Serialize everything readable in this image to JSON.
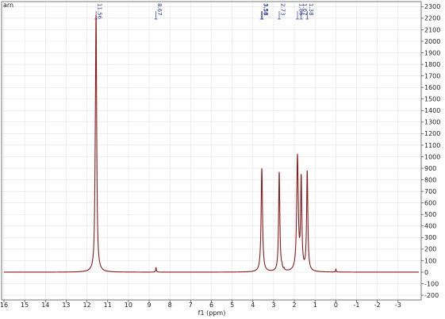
{
  "corner_label": "arn",
  "chart_data": {
    "type": "line",
    "title": "",
    "xlabel": "f1 (ppm)",
    "ylabel": "",
    "xlim": [
      16,
      -4
    ],
    "ylim": [
      -200,
      2400
    ],
    "x_reversed": true,
    "grid": true,
    "x_ticks": [
      16,
      15,
      14,
      13,
      12,
      11,
      10,
      9,
      8,
      7,
      6,
      5,
      4,
      3,
      2,
      1,
      0,
      -1,
      -2,
      -3
    ],
    "x_tick_labels": [
      "16",
      "15",
      "14",
      "13",
      "12",
      "11",
      "10",
      "9",
      "8",
      "7",
      "6",
      "5",
      "4",
      "3",
      "2",
      "1",
      "0",
      "-1",
      "-2",
      "-3"
    ],
    "y_ticks": [
      -200,
      -100,
      0,
      100,
      200,
      300,
      400,
      500,
      600,
      700,
      800,
      900,
      1000,
      1100,
      1200,
      1300,
      1400,
      1500,
      1600,
      1700,
      1800,
      1900,
      2000,
      2100,
      2200,
      2300
    ],
    "y_tick_labels": [
      "-200",
      "-100",
      "0",
      "100",
      "200",
      "300",
      "400",
      "500",
      "600",
      "700",
      "800",
      "900",
      "1000",
      "1100",
      "1200",
      "1300",
      "1400",
      "1500",
      "1600",
      "1700",
      "1800",
      "1900",
      "2000",
      "2100",
      "2200",
      "2300"
    ],
    "series": [
      {
        "color": "#8b1a1a",
        "baseline": 0,
        "peaks": [
          {
            "x": 11.56,
            "height": 2120,
            "width": 0.035
          },
          {
            "x": 11.6,
            "height": 300,
            "width": 0.03
          },
          {
            "x": 8.67,
            "height": 40,
            "width": 0.02
          },
          {
            "x": 3.57,
            "height": 895,
            "width": 0.04
          },
          {
            "x": 2.73,
            "height": 860,
            "width": 0.035
          },
          {
            "x": 2.6,
            "height": 25,
            "width": 0.02
          },
          {
            "x": 2.5,
            "height": 15,
            "width": 0.02
          },
          {
            "x": 1.85,
            "height": 985,
            "width": 0.045
          },
          {
            "x": 1.67,
            "height": 780,
            "width": 0.035
          },
          {
            "x": 1.38,
            "height": 860,
            "width": 0.035
          },
          {
            "x": 0.0,
            "height": 25,
            "width": 0.015
          }
        ]
      }
    ],
    "peak_annotations": [
      {
        "x": 11.56,
        "label": "11.56"
      },
      {
        "x": 8.67,
        "label": "8.67"
      },
      {
        "x": 3.58,
        "label": "3.58"
      },
      {
        "x": 3.55,
        "label": "3.56"
      },
      {
        "x": 2.73,
        "label": "2.73"
      },
      {
        "x": 1.85,
        "label": "1.86"
      },
      {
        "x": 1.67,
        "label": "1.67"
      },
      {
        "x": 1.38,
        "label": "1.38"
      }
    ]
  }
}
